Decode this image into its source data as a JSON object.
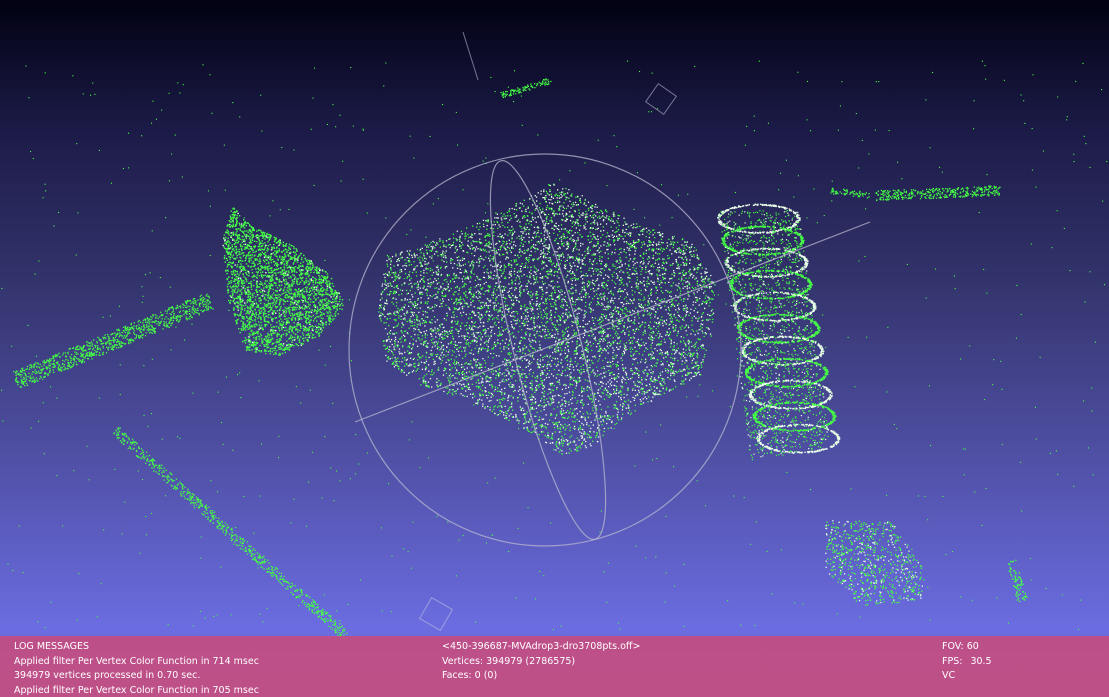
{
  "viewer": {
    "background_top": "#010112",
    "background_bottom": "#6f70e6",
    "point_color": "#44ff44",
    "highlight_color": "#e8ffe8",
    "trackball_color": "#b8b8d0"
  },
  "log": {
    "panel_color": "#c44d80",
    "title": "LOG MESSAGES",
    "lines": [
      "Applied filter Per Vertex Color Function in 714 msec",
      "394979 vertices processed in 0.70 sec.",
      "Applied filter Per Vertex Color Function in 705 msec"
    ]
  },
  "mesh": {
    "filename": "<450-396687-MVAdrop3-dro3708pts.off>",
    "vertices": "Vertices: 394979 (2786575)",
    "faces": "Faces: 0 (0)"
  },
  "stats": {
    "fov": "FOV: 60",
    "fps_label": "FPS:",
    "fps_value": "30.5",
    "mode": "VC"
  }
}
